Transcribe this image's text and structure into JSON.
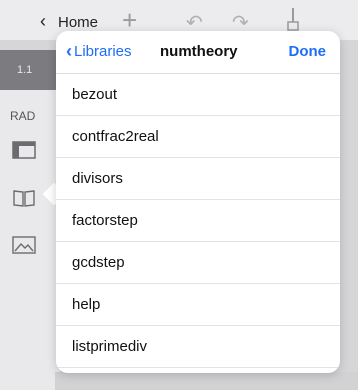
{
  "header": {
    "back_label": "Home",
    "tab_label": "1.1"
  },
  "left_pane": {
    "mode_label": "RAD"
  },
  "popover": {
    "back_label": "Libraries",
    "title": "numtheory",
    "done_label": "Done",
    "items": [
      {
        "label": "bezout"
      },
      {
        "label": "contfrac2real"
      },
      {
        "label": "divisors"
      },
      {
        "label": "factorstep"
      },
      {
        "label": "gcdstep"
      },
      {
        "label": "help"
      },
      {
        "label": "listprimediv"
      }
    ]
  },
  "colors": {
    "accent": "#1e6ff5",
    "background": "#d6d6d8"
  }
}
